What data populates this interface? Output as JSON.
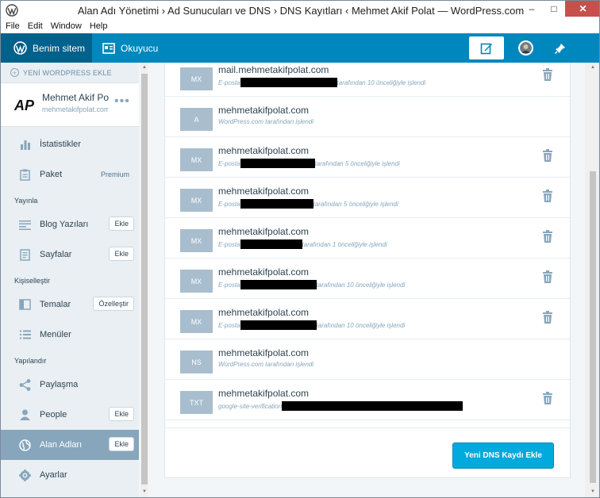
{
  "window": {
    "title": "Alan Adı Yönetimi › Ad Sunucuları ve DNS › DNS Kayıtları ‹ Mehmet Akif Polat — WordPress.com",
    "minimize": "–",
    "maximize": "□",
    "close": "✕"
  },
  "menubar": [
    "File",
    "Edit",
    "Window",
    "Help"
  ],
  "masterbar": {
    "my_site": "Benim sitem",
    "reader": "Okuyucu"
  },
  "sidebar": {
    "add_site": "YENİ WORDPRESS EKLE",
    "site_title": "Mehmet Akif Polat",
    "site_domain": "mehmetakifpolat.com",
    "logo_text": "AP",
    "items": {
      "stats": "İstatistikler",
      "plan": "Paket",
      "plan_badge": "Premium",
      "publish_head": "Yayınla",
      "posts": "Blog Yazıları",
      "posts_btn": "Ekle",
      "pages": "Sayfalar",
      "pages_btn": "Ekle",
      "personalize_head": "Kişiselleştir",
      "themes": "Temalar",
      "themes_btn": "Özelleştir",
      "menus": "Menüler",
      "configure_head": "Yapılandır",
      "sharing": "Paylaşma",
      "people": "People",
      "people_btn": "Ekle",
      "domains": "Alan Adları",
      "domains_btn": "Ekle",
      "settings": "Ayarlar"
    }
  },
  "dns_records": [
    {
      "type": "MX",
      "host": "mail.mehmetakifpolat.com",
      "desc_before": "E-posta",
      "desc_after": "tarafından 10 önceliğiyle işlendi",
      "deletable": true
    },
    {
      "type": "A",
      "host": "mehmetakifpolat.com",
      "desc_before": "WordPress.com tarafından işlendi",
      "desc_after": "",
      "deletable": false
    },
    {
      "type": "MX",
      "host": "mehmetakifpolat.com",
      "desc_before": "E-posta",
      "desc_after": "tarafından 5 önceliğiyle işlendi",
      "deletable": true
    },
    {
      "type": "MX",
      "host": "mehmetakifpolat.com",
      "desc_before": "E-posta",
      "desc_after": "tarafından 5 önceliğiyle işlendi",
      "deletable": true
    },
    {
      "type": "MX",
      "host": "mehmetakifpolat.com",
      "desc_before": "E-posta",
      "desc_after": "tarafından 1 önceliğiyle işlendi",
      "deletable": true
    },
    {
      "type": "MX",
      "host": "mehmetakifpolat.com",
      "desc_before": "E-posta",
      "desc_after": "tarafından 10 önceliğiyle işlendi",
      "deletable": true
    },
    {
      "type": "MX",
      "host": "mehmetakifpolat.com",
      "desc_before": "E-posta",
      "desc_after": "tarafından 10 önceliğiyle işlendi",
      "deletable": true
    },
    {
      "type": "NS",
      "host": "mehmetakifpolat.com",
      "desc_before": "WordPress.com tarafından işlendi",
      "desc_after": "",
      "deletable": false
    },
    {
      "type": "TXT",
      "host": "mehmetakifpolat.com",
      "desc_before": "google-site-verification",
      "desc_after": "",
      "deletable": true
    }
  ],
  "add_dns_button": "Yeni DNS Kaydı Ekle",
  "colors": {
    "masterbar": "#0087be",
    "masterbar_active": "#00618a",
    "sidebar_bg": "#e9eff3",
    "sidebar_selected": "#87a6bc",
    "type_badge": "#a8bece",
    "primary_button": "#00aadc",
    "text": "#2e4453",
    "muted": "#87a6bc"
  },
  "icons": {
    "app": "wordpress-logo-icon",
    "reader": "reader-icon",
    "write": "write-post-icon",
    "notifications": "notification-bell-icon",
    "delete": "trash-icon"
  }
}
